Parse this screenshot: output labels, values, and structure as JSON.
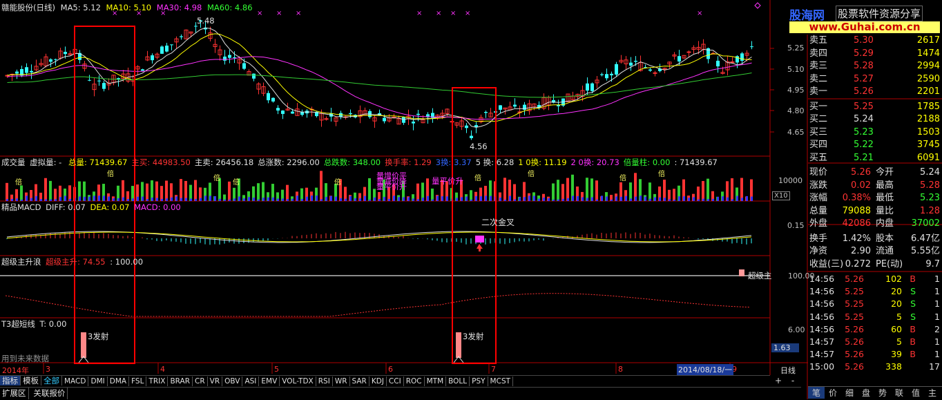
{
  "window": {
    "title": "赣能股份(日线)"
  },
  "indicators": {
    "ma5_label": "MA5: 5.12",
    "ma10_label": "MA10: 5.10",
    "ma30_label": "MA30: 4.98",
    "ma60_label": "MA60: 4.86",
    "high_mark": "5.48",
    "low_mark": "4.56",
    "price_axis": [
      "5.25",
      "5.10",
      "4.95",
      "4.80",
      "4.65"
    ]
  },
  "volume_panel": {
    "title": "成交量",
    "virtual": "虚拟量: -",
    "items": [
      {
        "text": "总量: 71439.67",
        "color": "#ffff00"
      },
      {
        "text": "主买: 44983.50",
        "color": "#ff3333"
      },
      {
        "text": "主卖: 26456.18",
        "color": "#e0e0e0"
      },
      {
        "text": "总涨数: 2296.00",
        "color": "#e0e0e0"
      },
      {
        "text": "总跌数: 348.00",
        "color": "#33ff33"
      },
      {
        "text": "换手率: 1.29",
        "color": "#ff3333"
      },
      {
        "text": "3换: 3.37",
        "color": "#3366ff"
      },
      {
        "text": "5 换: 6.28",
        "color": "#e0e0e0"
      },
      {
        "text": "1 0换: 11.19",
        "color": "#ffff00"
      },
      {
        "text": "2 0换: 20.73",
        "color": "#ff33ff"
      },
      {
        "text": "倍量柱: 0.00",
        "color": "#33ff33"
      },
      {
        "text": ": 71439.67",
        "color": "#e0e0e0"
      }
    ],
    "axis_label": "10000",
    "axis_unit": "X10",
    "annotations": [
      "量增价平",
      "量平价升",
      "量减价降",
      "量平价升"
    ],
    "bei_label": "倍"
  },
  "macd_panel": {
    "title": "精品MACD",
    "diff": "DIFF: 0.07",
    "dea": "DEA: 0.07",
    "macd": "MACD: 0.00",
    "axis_label": "0.15",
    "annotation": "二次金叉"
  },
  "super_panel": {
    "title": "超级主升浪",
    "value_label": "超级主升: 74.55",
    "value2": ": 100.00",
    "axis_label": "100.00",
    "end_label": "超级主"
  },
  "t3_panel": {
    "title": "T3超短线",
    "t_value": "T: 0.00",
    "axis_label": "6.00",
    "side_value": "1.63",
    "signal_label": "3发射",
    "footer_note": "用到未来数据"
  },
  "time_axis": {
    "labels": [
      "2014年",
      "3",
      "4",
      "5",
      "6",
      "7",
      "8",
      "9"
    ],
    "date_box": "2014/08/18/一",
    "period": "日线"
  },
  "bottom_tabs": [
    "指标",
    "模板",
    "全部",
    "MACD",
    "DMI",
    "DMA",
    "FSL",
    "TRIX",
    "BRAR",
    "CR",
    "VR",
    "OBV",
    "ASI",
    "EMV",
    "VOL-TDX",
    "RSI",
    "WR",
    "SAR",
    "KDJ",
    "CCI",
    "ROC",
    "MTM",
    "BOLL",
    "PSY",
    "MCST"
  ],
  "bottom_tabs2": [
    "扩展区",
    "关联报价"
  ],
  "zoom_buttons": [
    "+",
    "-"
  ],
  "logo": {
    "line1": "股海网",
    "line2": "股票软件资源分享",
    "url": "www.Guhai.com.cn"
  },
  "order_book": {
    "sells": [
      {
        "label": "卖五",
        "price": "5.30",
        "vol": "2617"
      },
      {
        "label": "卖四",
        "price": "5.29",
        "vol": "1474"
      },
      {
        "label": "卖三",
        "price": "5.28",
        "vol": "2994"
      },
      {
        "label": "卖二",
        "price": "5.27",
        "vol": "2590"
      },
      {
        "label": "卖一",
        "price": "5.26",
        "vol": "2201"
      }
    ],
    "buys": [
      {
        "label": "买一",
        "price": "5.25",
        "vol": "1785"
      },
      {
        "label": "买二",
        "price": "5.24",
        "vol": "2188"
      },
      {
        "label": "买三",
        "price": "5.23",
        "vol": "1503"
      },
      {
        "label": "买四",
        "price": "5.22",
        "vol": "3745"
      },
      {
        "label": "买五",
        "price": "5.21",
        "vol": "6091"
      }
    ]
  },
  "stats": [
    {
      "l1": "现价",
      "v1": "5.26",
      "c1": "#ff3333",
      "l2": "今开",
      "v2": "5.24",
      "c2": "#e0e0e0"
    },
    {
      "l1": "涨跌",
      "v1": "0.02",
      "c1": "#ff3333",
      "l2": "最高",
      "v2": "5.28",
      "c2": "#ff3333"
    },
    {
      "l1": "涨幅",
      "v1": "0.38%",
      "c1": "#ff3333",
      "l2": "最低",
      "v2": "5.23",
      "c2": "#33ff33"
    },
    {
      "l1": "总量",
      "v1": "79088",
      "c1": "#ffff00",
      "l2": "量比",
      "v2": "1.28",
      "c2": "#ff3333"
    },
    {
      "l1": "外盘",
      "v1": "42086",
      "c1": "#ff3333",
      "l2": "内盘",
      "v2": "37002",
      "c2": "#33ff33"
    }
  ],
  "stats2": [
    {
      "l1": "换手",
      "v1": "1.42%",
      "l2": "股本",
      "v2": "6.47亿"
    },
    {
      "l1": "净资",
      "v1": "2.90",
      "l2": "流通",
      "v2": "5.55亿"
    },
    {
      "l1": "收益(三)",
      "v1": "0.272",
      "l2": "PE(动)",
      "v2": "9.7"
    }
  ],
  "ticks": [
    {
      "time": "14:56",
      "price": "5.26",
      "vol": "102",
      "side": "B",
      "extra": "1"
    },
    {
      "time": "14:56",
      "price": "5.25",
      "vol": "20",
      "side": "S",
      "extra": "1"
    },
    {
      "time": "14:56",
      "price": "5.25",
      "vol": "20",
      "side": "S",
      "extra": "1"
    },
    {
      "time": "14:56",
      "price": "5.25",
      "vol": "5",
      "side": "S",
      "extra": "1"
    },
    {
      "time": "14:56",
      "price": "5.26",
      "vol": "60",
      "side": "B",
      "extra": "2"
    },
    {
      "time": "14:57",
      "price": "5.26",
      "vol": "5",
      "side": "B",
      "extra": "1"
    },
    {
      "time": "14:57",
      "price": "5.26",
      "vol": "39",
      "side": "B",
      "extra": "1"
    },
    {
      "time": "15:00",
      "price": "5.26",
      "vol": "338",
      "side": "",
      "extra": "17"
    }
  ],
  "right_bottom_tabs": [
    "笔",
    "价",
    "细",
    "盘",
    "势",
    "联",
    "值",
    "主"
  ]
}
